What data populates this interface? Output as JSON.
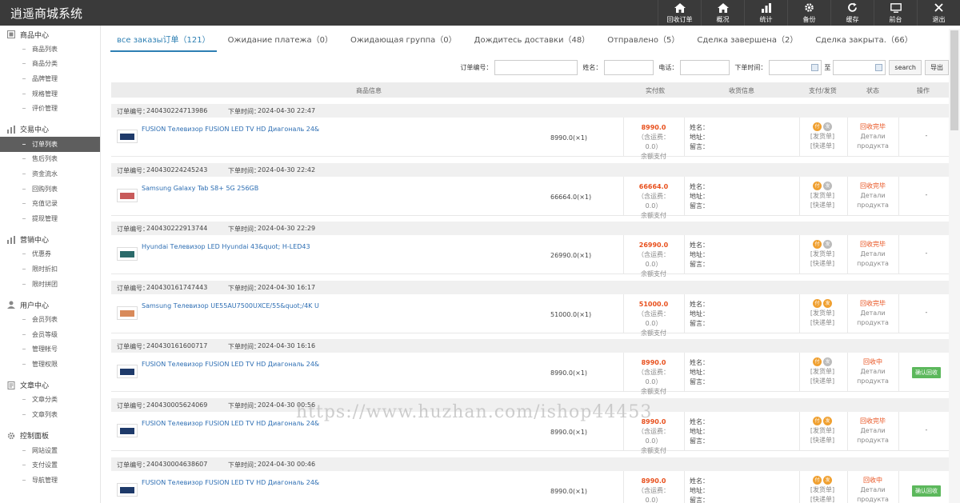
{
  "app": {
    "title": "逍遥商城系统"
  },
  "topnav": [
    {
      "label": "回收订单",
      "icon": "home-icon"
    },
    {
      "label": "概况",
      "icon": "home-icon"
    },
    {
      "label": "统计",
      "icon": "bar-chart-icon"
    },
    {
      "label": "备份",
      "icon": "gear-icon"
    },
    {
      "label": "缓存",
      "icon": "refresh-icon"
    },
    {
      "label": "前台",
      "icon": "monitor-icon"
    },
    {
      "label": "退出",
      "icon": "close-icon"
    }
  ],
  "sidebar": [
    {
      "title": "商品中心",
      "icon": "grid-icon",
      "items": [
        "商品列表",
        "商品分类",
        "品牌管理",
        "规格管理",
        "评价管理"
      ]
    },
    {
      "title": "交易中心",
      "icon": "chart-icon",
      "items": [
        "订单列表",
        "售后列表",
        "资金流水",
        "回购列表",
        "充值记录",
        "提现管理"
      ]
    },
    {
      "title": "营销中心",
      "icon": "chart-icon",
      "items": [
        "优惠券",
        "限时折扣",
        "限时拼团"
      ]
    },
    {
      "title": "用户中心",
      "icon": "user-icon",
      "items": [
        "会员列表",
        "会员等级",
        "管理帐号",
        "管理权限"
      ]
    },
    {
      "title": "文章中心",
      "icon": "document-icon",
      "items": [
        "文章分类",
        "文章列表"
      ]
    },
    {
      "title": "控制面板",
      "icon": "gear-icon",
      "items": [
        "网站设置",
        "支付设置",
        "导航管理"
      ]
    }
  ],
  "sidebar_active": "订单列表",
  "tabs": [
    "все заказы订单（121）",
    "Ожидание платежа（0）",
    "Ожидающая группа（0）",
    "Дождитесь доставки（48）",
    "Отправлено（5）",
    "Сделка завершена（2）",
    "Сделка закрыта.（66）"
  ],
  "filters": {
    "order_no": "订单编号：",
    "name": "姓名：",
    "phone": "电话：",
    "time": "下单时间：",
    "to": "至",
    "search": "search",
    "export": "导出"
  },
  "columns": {
    "info": "商品信息",
    "paid": "实付款",
    "ship": "收货信息",
    "payship": "支付/发货",
    "status": "状态",
    "op": "操作"
  },
  "labels": {
    "order_no": "订单编号：",
    "order_time": "下单时间：",
    "shipping": "（含运费：0.0）",
    "pay_method": "余额支付",
    "name": "姓名：",
    "addr": "地址：",
    "note": "留言：",
    "pay_icon": "付",
    "ship_icon": "发",
    "ship_order": "[发货单]",
    "express": "[快递单]",
    "detail1": "Детали",
    "detail2": "продукта"
  },
  "orders": [
    {
      "no": "240430224713986",
      "time": "2024-04-30 22:47",
      "product": "FUSION Телевизор FUSION LED TV HD Диагональ 24&",
      "qty": "8990.0(×1)",
      "amount": "8990.0",
      "status": "回收完毕",
      "op": "-",
      "op_button": false,
      "thumb": "#1e3a6a"
    },
    {
      "no": "240430224245243",
      "time": "2024-04-30 22:42",
      "product": "Samsung Galaxy Tab S8+ 5G 256GB",
      "qty": "66664.0(×1)",
      "amount": "66664.0",
      "status": "回收完毕",
      "op": "-",
      "op_button": false,
      "thumb": "#c85a5a"
    },
    {
      "no": "240430222913744",
      "time": "2024-04-30 22:29",
      "product": "Hyundai Телевизор LED Hyundai 43&quot; H-LED43",
      "qty": "26990.0(×1)",
      "amount": "26990.0",
      "status": "回收完毕",
      "op": "-",
      "op_button": false,
      "thumb": "#2a6a6a"
    },
    {
      "no": "240430161747443",
      "time": "2024-04-30 16:17",
      "product": "Samsung Телевизор UE55AU7500UXCE/55&quot;/4K U",
      "qty": "51000.0(×1)",
      "amount": "51000.0",
      "status": "回收完毕",
      "op": "-",
      "op_button": false,
      "thumb": "#d88a5a"
    },
    {
      "no": "240430161600717",
      "time": "2024-04-30 16:16",
      "product": "FUSION Телевизор FUSION LED TV HD Диагональ 24&",
      "qty": "8990.0(×1)",
      "amount": "8990.0",
      "status": "回收中",
      "op": "确认回收",
      "op_button": true,
      "thumb": "#1e3a6a"
    },
    {
      "no": "240430005624069",
      "time": "2024-04-30 00:56",
      "product": "FUSION Телевизор FUSION LED TV HD Диагональ 24&",
      "qty": "8990.0(×1)",
      "amount": "8990.0",
      "status": "回收完毕",
      "op": "-",
      "op_button": false,
      "thumb": "#1e3a6a"
    },
    {
      "no": "240430004638607",
      "time": "2024-04-30 00:46",
      "product": "FUSION Телевизор FUSION LED TV HD Диагональ 24&",
      "qty": "8990.0(×1)",
      "amount": "8990.0",
      "status": "回收中",
      "op": "确认回收",
      "op_button": true,
      "thumb": "#1e3a6a"
    }
  ],
  "watermark": "https://www.huzhan.com/ishop44453"
}
